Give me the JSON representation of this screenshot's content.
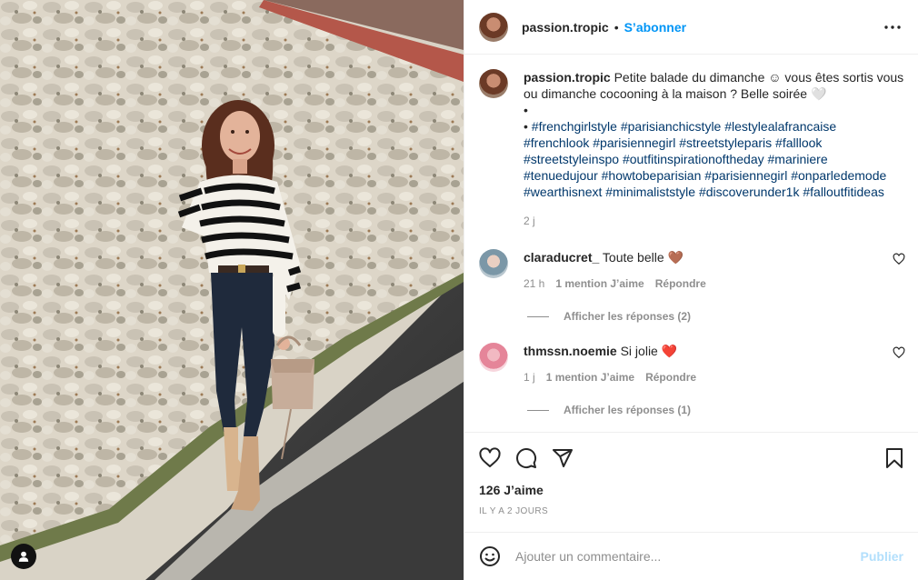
{
  "post": {
    "username": "passion.tropic",
    "follow_label": "S’abonner",
    "header_separator": "•",
    "more_icon": "more-horizontal-icon"
  },
  "caption": {
    "username": "passion.tropic",
    "text": "Petite balade du dimanche ☺ vous êtes sortis vous ou dimanche cocooning à la maison ? Belle soirée 🤍",
    "bullet_1": "•",
    "bullet_2": "•",
    "hashtags": "#frenchgirlstyle #parisianchicstyle #lestylealafrancaise #frenchlook #parisiennegirl #streetstyleparis #falllook #streetstyleinspo #outfitinspirationoftheday #mariniere #tenuedujour #howtobeparisian #parisiennegirl #onparledemode #wearthisnext #minimaliststyle #discoverunder1k #falloutfitideas",
    "time": "2 j"
  },
  "comments": [
    {
      "username": "claraducret_",
      "text": "Toute belle 🤎",
      "time": "21 h",
      "likes": "1 mention J’aime",
      "reply": "Répondre",
      "view_replies": "Afficher les réponses (2)"
    },
    {
      "username": "thmssn.noemie",
      "text": "Si jolie ❤️",
      "time": "1 j",
      "likes": "1 mention J’aime",
      "reply": "Répondre",
      "view_replies": "Afficher les réponses (1)"
    }
  ],
  "actions": {
    "like_icon": "heart-icon",
    "comment_icon": "comment-bubble-icon",
    "share_icon": "paper-plane-icon",
    "save_icon": "bookmark-icon"
  },
  "likes_count": "126 J’aime",
  "posted_ago": "IL Y A 2 JOURS",
  "add_comment": {
    "placeholder": "Ajouter un commentaire...",
    "publish_label": "Publier",
    "emoji_icon": "smiley-icon"
  },
  "colors": {
    "link_blue": "#0095f6",
    "hashtag_blue": "#00376b",
    "muted": "#8e8e8e",
    "publish_disabled": "#b2dffc"
  }
}
